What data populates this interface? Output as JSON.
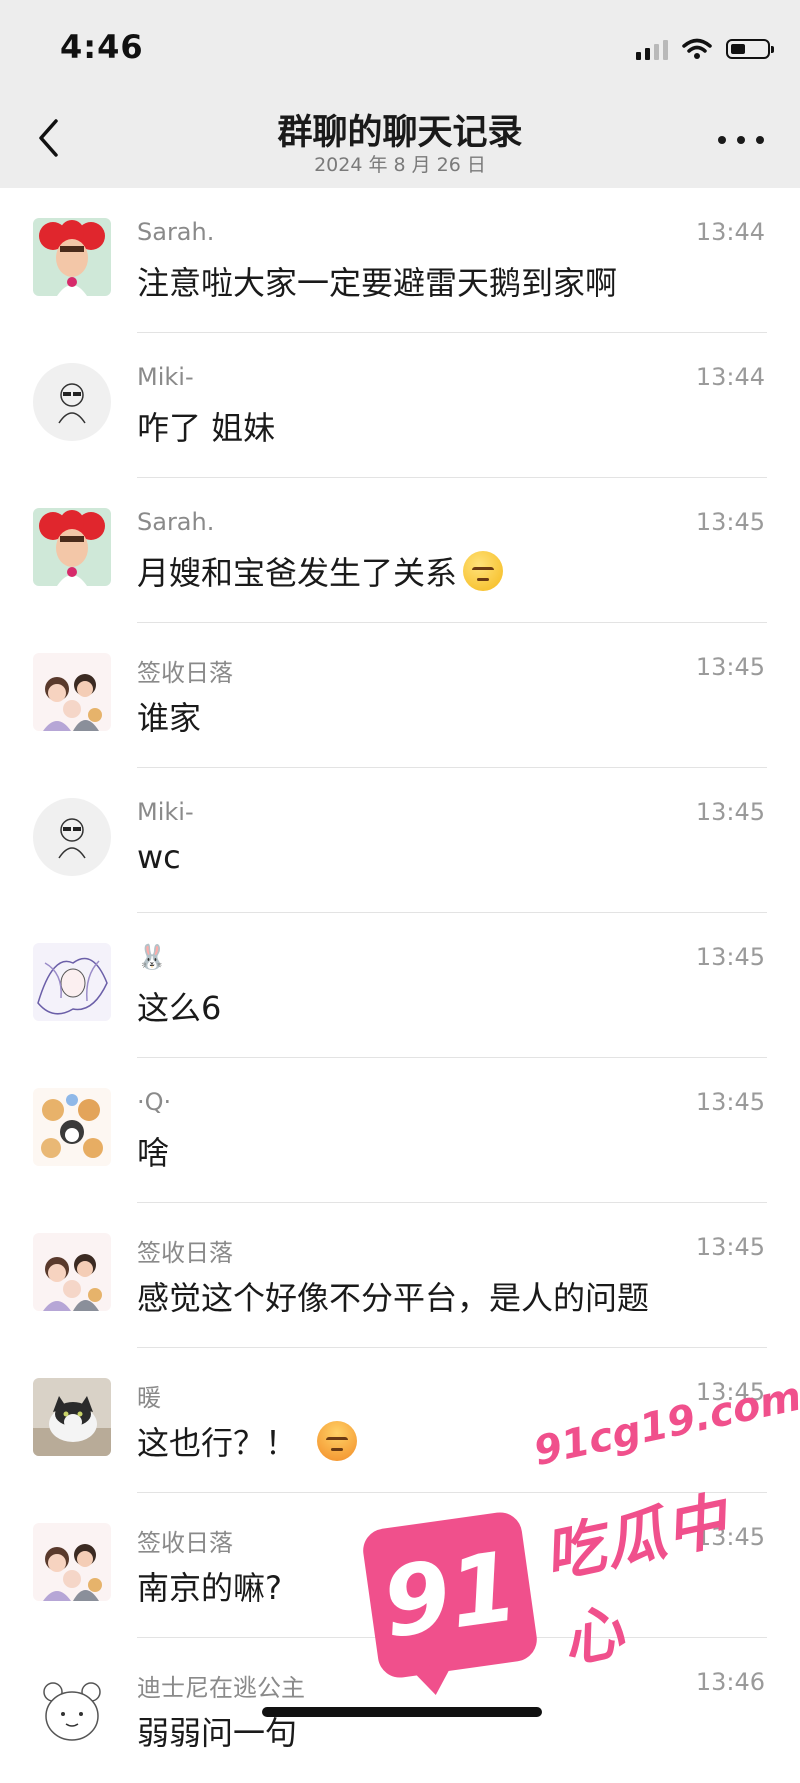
{
  "status_bar": {
    "time": "4:46"
  },
  "nav": {
    "title": "群聊的聊天记录",
    "subtitle": "2024 年 8 月 26 日"
  },
  "messages": [
    {
      "sender": "Sarah.",
      "time": "13:44",
      "text": "注意啦大家一定要避雷天鹅到家啊",
      "avatar": "avatar-sarah"
    },
    {
      "sender": "Miki-",
      "time": "13:44",
      "text": "咋了 姐妹",
      "avatar": "avatar-miki"
    },
    {
      "sender": "Sarah.",
      "time": "13:45",
      "text": "月嫂和宝爸发生了关系",
      "emoji": "unamused-sweat-emoji",
      "avatar": "avatar-sarah"
    },
    {
      "sender": "签收日落",
      "time": "13:45",
      "text": "谁家",
      "avatar": "avatar-family"
    },
    {
      "sender": "Miki-",
      "time": "13:45",
      "text": "wc",
      "avatar": "avatar-miki"
    },
    {
      "sender": "🐰",
      "time": "13:45",
      "text": "这么6",
      "avatar": "avatar-sketch"
    },
    {
      "sender": "·Q·",
      "time": "13:45",
      "text": "啥",
      "avatar": "avatar-dogs"
    },
    {
      "sender": "签收日落",
      "time": "13:45",
      "text": "感觉这个好像不分平台，是人的问题",
      "avatar": "avatar-family"
    },
    {
      "sender": "暖",
      "time": "13:45",
      "text": "这也行？！",
      "emoji": "exploding-head-emoji",
      "avatar": "avatar-cat"
    },
    {
      "sender": "签收日落",
      "time": "13:45",
      "text": "南京的嘛?",
      "avatar": "avatar-family"
    },
    {
      "sender": "迪士尼在逃公主",
      "time": "13:46",
      "text": "弱弱问一句",
      "avatar": "avatar-bear"
    }
  ],
  "watermark": {
    "url": "91cg19.com",
    "badge": "91",
    "label": "吃瓜中心"
  },
  "colors": {
    "topbar": "#ededed",
    "watermark": "#f0508c",
    "divider": "#e3e3e3"
  }
}
